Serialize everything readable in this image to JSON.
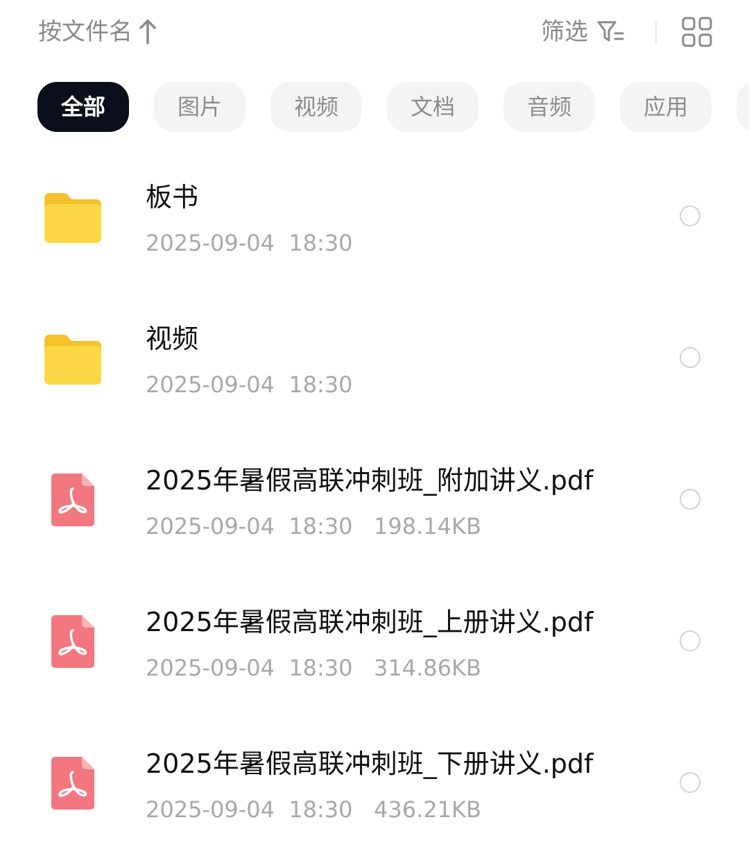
{
  "toolbar": {
    "sort_label": "按文件名",
    "sort_icon": "arrow-up-icon",
    "filter_label": "筛选",
    "filter_icon": "filter-icon",
    "view_icon": "grid-view-icon"
  },
  "categories": [
    {
      "label": "全部",
      "active": true
    },
    {
      "label": "图片",
      "active": false
    },
    {
      "label": "视频",
      "active": false
    },
    {
      "label": "文档",
      "active": false
    },
    {
      "label": "音频",
      "active": false
    },
    {
      "label": "应用",
      "active": false
    }
  ],
  "files": [
    {
      "name": "板书",
      "date": "2025-09-04",
      "time": "18:30",
      "size": "",
      "type": "folder"
    },
    {
      "name": "视频",
      "date": "2025-09-04",
      "time": "18:30",
      "size": "",
      "type": "folder"
    },
    {
      "name": "2025年暑假高联冲刺班_附加讲义.pdf",
      "date": "2025-09-04",
      "time": "18:30",
      "size": "198.14KB",
      "type": "pdf"
    },
    {
      "name": "2025年暑假高联冲刺班_上册讲义.pdf",
      "date": "2025-09-04",
      "time": "18:30",
      "size": "314.86KB",
      "type": "pdf"
    },
    {
      "name": "2025年暑假高联冲刺班_下册讲义.pdf",
      "date": "2025-09-04",
      "time": "18:30",
      "size": "436.21KB",
      "type": "pdf"
    }
  ],
  "colors": {
    "chip_active_bg": "#0b0f1a",
    "chip_bg": "#f3f4f6",
    "folder": "#fbd746",
    "pdf": "#f2777f",
    "meta_text": "#a8a8a8"
  }
}
